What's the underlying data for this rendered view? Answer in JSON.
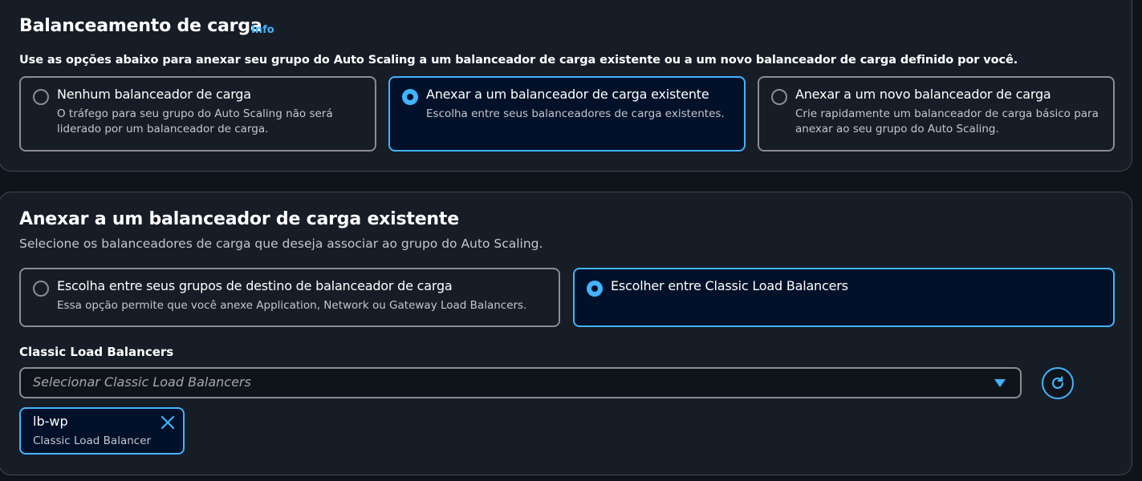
{
  "load_balancing": {
    "title": "Balanceamento de carga",
    "info_label": "Info",
    "description": "Use as opções abaixo para anexar seu grupo do Auto Scaling a um balanceador de carga existente ou a um novo balanceador de carga definido por você.",
    "options": [
      {
        "title": "Nenhum balanceador de carga",
        "desc_line1": "O tráfego para seu grupo do Auto Scaling não será",
        "desc_line2": "liderado por um balanceador de carga.",
        "selected": false
      },
      {
        "title": "Anexar a um balanceador de carga existente",
        "desc_line1": "Escolha entre seus balanceadores de carga existentes.",
        "desc_line2": "",
        "selected": true
      },
      {
        "title": "Anexar a um novo balanceador de carga",
        "desc_line1": "Crie rapidamente um balanceador de carga básico para",
        "desc_line2": "anexar ao seu grupo do Auto Scaling.",
        "selected": false
      }
    ]
  },
  "existing_lb": {
    "title": "Anexar a um balanceador de carga existente",
    "description": "Selecione os balanceadores de carga que deseja associar ao grupo do Auto Scaling.",
    "options": [
      {
        "title": "Escolha entre seus grupos de destino de balanceador de carga",
        "desc": "Essa opção permite que você anexe Application, Network ou Gateway Load Balancers.",
        "selected": false
      },
      {
        "title": "Escolher entre Classic Load Balancers",
        "desc": "",
        "selected": true
      }
    ],
    "field_label": "Classic Load Balancers",
    "select_placeholder": "Selecionar Classic Load Balancers",
    "tokens": [
      {
        "name": "lb-wp",
        "type": "Classic Load Balancer"
      }
    ]
  },
  "colors": {
    "accent": "#42b4ff",
    "background": "#0f141a",
    "panel": "#161d26",
    "selected_tile": "#001129"
  },
  "icons": [
    "radio-icon",
    "caret-down-icon",
    "refresh-icon",
    "close-icon"
  ]
}
